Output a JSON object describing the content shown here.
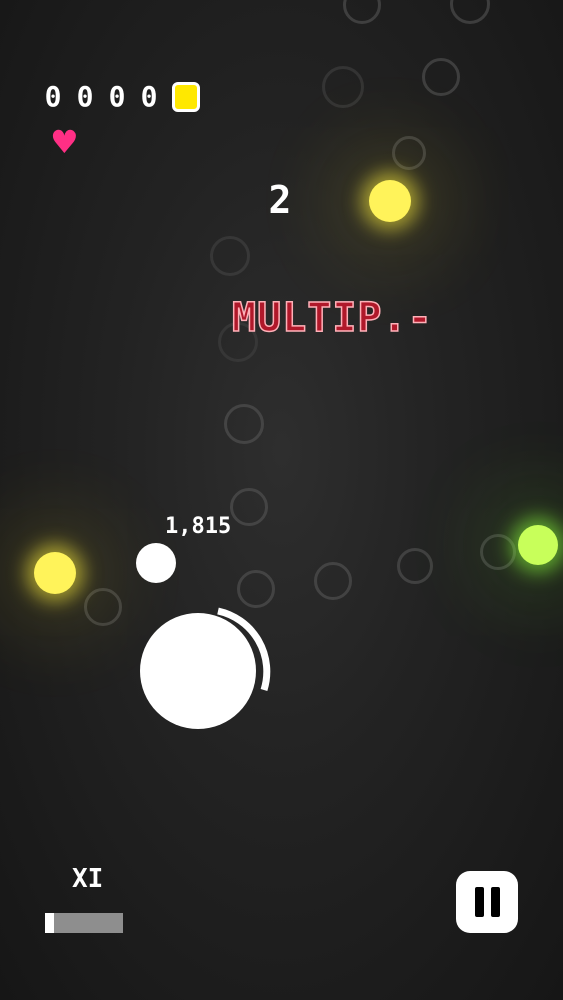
{
  "hud": {
    "score_digits": [
      "0",
      "0",
      "0",
      "0"
    ],
    "coin_color": "#ffe800",
    "lives_icon": "heart-icon",
    "lives": 1,
    "level": "2",
    "multiplier_label": "XI",
    "multiplier_progress": 0.12
  },
  "messages": {
    "powerup_text": "MULTIP.-",
    "floating_score": "1,815"
  },
  "colors": {
    "background": "#1b1b1b",
    "heart": "#ff2f85",
    "powerup_text": "#b0182a",
    "yellow_orb": "#fff35a",
    "green_orb": "#c8ff5a"
  },
  "controls": {
    "pause_icon": "pause-icon"
  }
}
